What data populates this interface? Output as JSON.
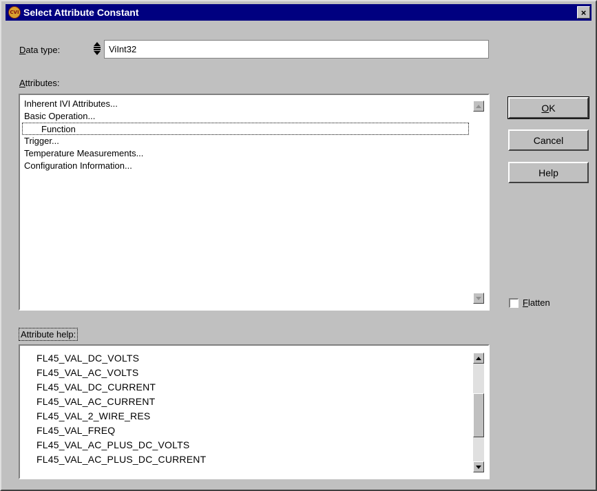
{
  "window": {
    "title": "Select Attribute Constant",
    "close_label": "×",
    "app_icon_text": "CVI"
  },
  "data_type": {
    "label_accel": "D",
    "label_rest": "ata type:",
    "value": "ViInt32"
  },
  "attributes": {
    "label_accel": "A",
    "label_rest": "ttributes:",
    "items": [
      {
        "text": "Inherent IVI Attributes...",
        "indent": false,
        "focused": false
      },
      {
        "text": "Basic Operation...",
        "indent": false,
        "focused": false
      },
      {
        "text": "Function",
        "indent": true,
        "focused": true
      },
      {
        "text": "Trigger...",
        "indent": false,
        "focused": false
      },
      {
        "text": "Temperature Measurements...",
        "indent": false,
        "focused": false
      },
      {
        "text": "Configuration Information...",
        "indent": false,
        "focused": false
      }
    ]
  },
  "buttons": {
    "ok_accel": "O",
    "ok_rest": "K",
    "cancel": "Cancel",
    "help": "Help"
  },
  "flatten": {
    "label_accel": "F",
    "label_rest": "latten",
    "checked": false
  },
  "attribute_help": {
    "label": "Attribute help:",
    "items": [
      "FL45_VAL_DC_VOLTS",
      "FL45_VAL_AC_VOLTS",
      "FL45_VAL_DC_CURRENT",
      "FL45_VAL_AC_CURRENT",
      "FL45_VAL_2_WIRE_RES",
      "FL45_VAL_FREQ",
      "FL45_VAL_AC_PLUS_DC_VOLTS",
      "FL45_VAL_AC_PLUS_DC_CURRENT"
    ],
    "scroll_position": 0.55,
    "scroll_visible_fraction": 0.45
  },
  "colors": {
    "titlebar": "#000080",
    "face": "#c0c0c0",
    "window": "#ffffff"
  }
}
